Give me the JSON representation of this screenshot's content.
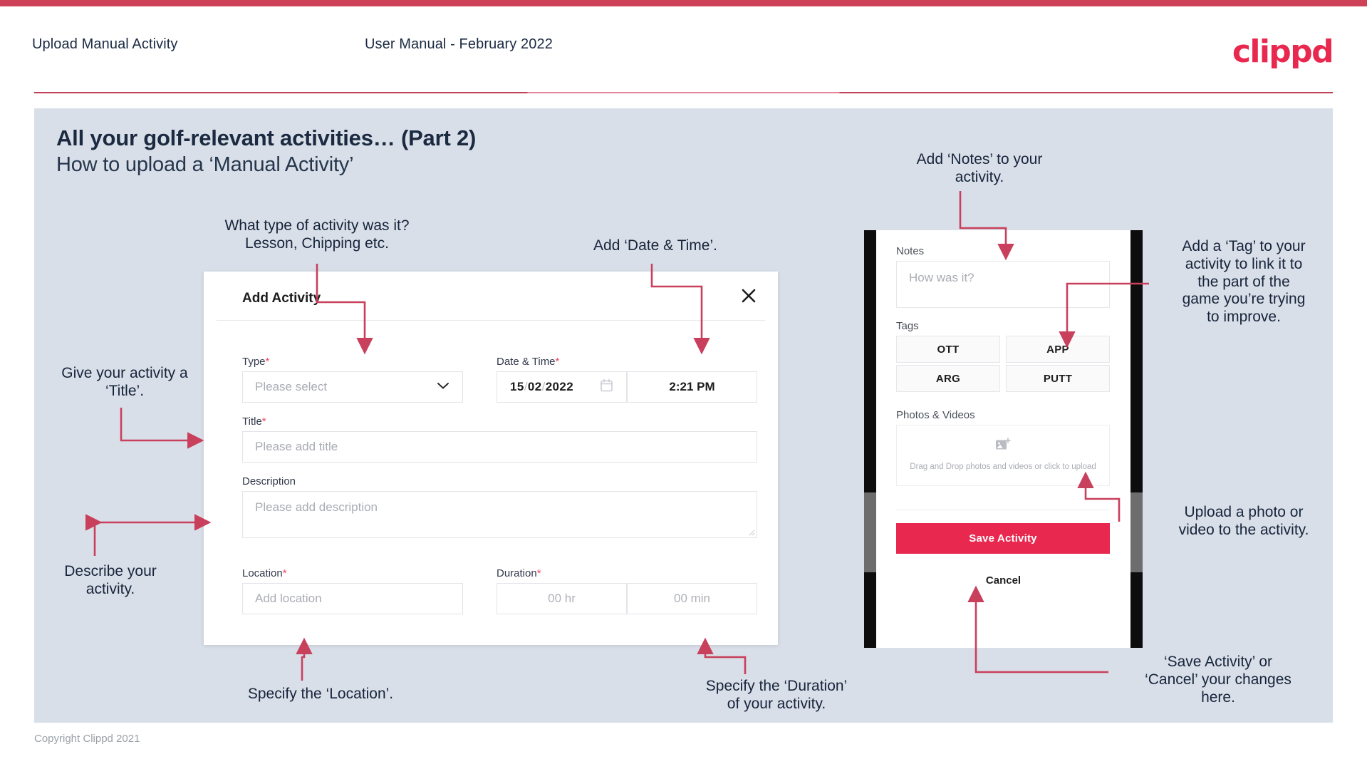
{
  "header": {
    "left_title": "Upload Manual Activity",
    "center_title": "User Manual - February 2022",
    "logo": "clippd"
  },
  "slide": {
    "title_main": "All your golf-relevant activities… (Part 2)",
    "title_sub": "How to upload a ‘Manual Activity’",
    "copyright": "Copyright Clippd 2021"
  },
  "modal": {
    "title": "Add Activity",
    "close_icon": "close-icon",
    "fields": {
      "type": {
        "label": "Type",
        "required": "*",
        "placeholder": "Please select",
        "chevron": "chevron-down-icon"
      },
      "datetime": {
        "label": "Date & Time",
        "required": "*",
        "day": "15",
        "month": "02",
        "year": "2022",
        "sep": "/",
        "calendar_icon": "calendar-icon",
        "time": "2:21 PM"
      },
      "title": {
        "label": "Title",
        "required": "*",
        "placeholder": "Please add title"
      },
      "description": {
        "label": "Description",
        "required": "",
        "placeholder": "Please add description"
      },
      "location": {
        "label": "Location",
        "required": "*",
        "placeholder": "Add location"
      },
      "duration": {
        "label": "Duration",
        "required": "*",
        "hours": "00 hr",
        "minutes": "00 min"
      }
    }
  },
  "phone": {
    "notes": {
      "label": "Notes",
      "placeholder": "How was it?"
    },
    "tags": {
      "label": "Tags",
      "items": [
        "OTT",
        "APP",
        "ARG",
        "PUTT"
      ]
    },
    "photos": {
      "label": "Photos & Videos",
      "icon": "add-image-icon",
      "drop_text": "Drag and Drop photos and videos or\nclick to upload"
    },
    "save_label": "Save Activity",
    "cancel_label": "Cancel"
  },
  "annotations": {
    "type": "What type of activity was it?\nLesson, Chipping etc.",
    "datetime": "Add ‘Date & Time’.",
    "title": "Give your activity a\n‘Title’.",
    "description": "Describe your\nactivity.",
    "location": "Specify the ‘Location’.",
    "duration": "Specify the ‘Duration’\nof your activity.",
    "notes": "Add ‘Notes’ to your\nactivity.",
    "tags": "Add a ‘Tag’ to your\nactivity to link it to\nthe part of the\ngame you’re trying\nto improve.",
    "photos": "Upload a photo or\nvideo to the activity.",
    "save": "‘Save Activity’ or\n‘Cancel’ your changes\nhere."
  },
  "colors": {
    "brand": "#e8284e",
    "accent_rule": "#cf4159",
    "arrow": "#c8405c",
    "slide_bg": "#d9dfe8",
    "text_dark": "#16243b"
  }
}
